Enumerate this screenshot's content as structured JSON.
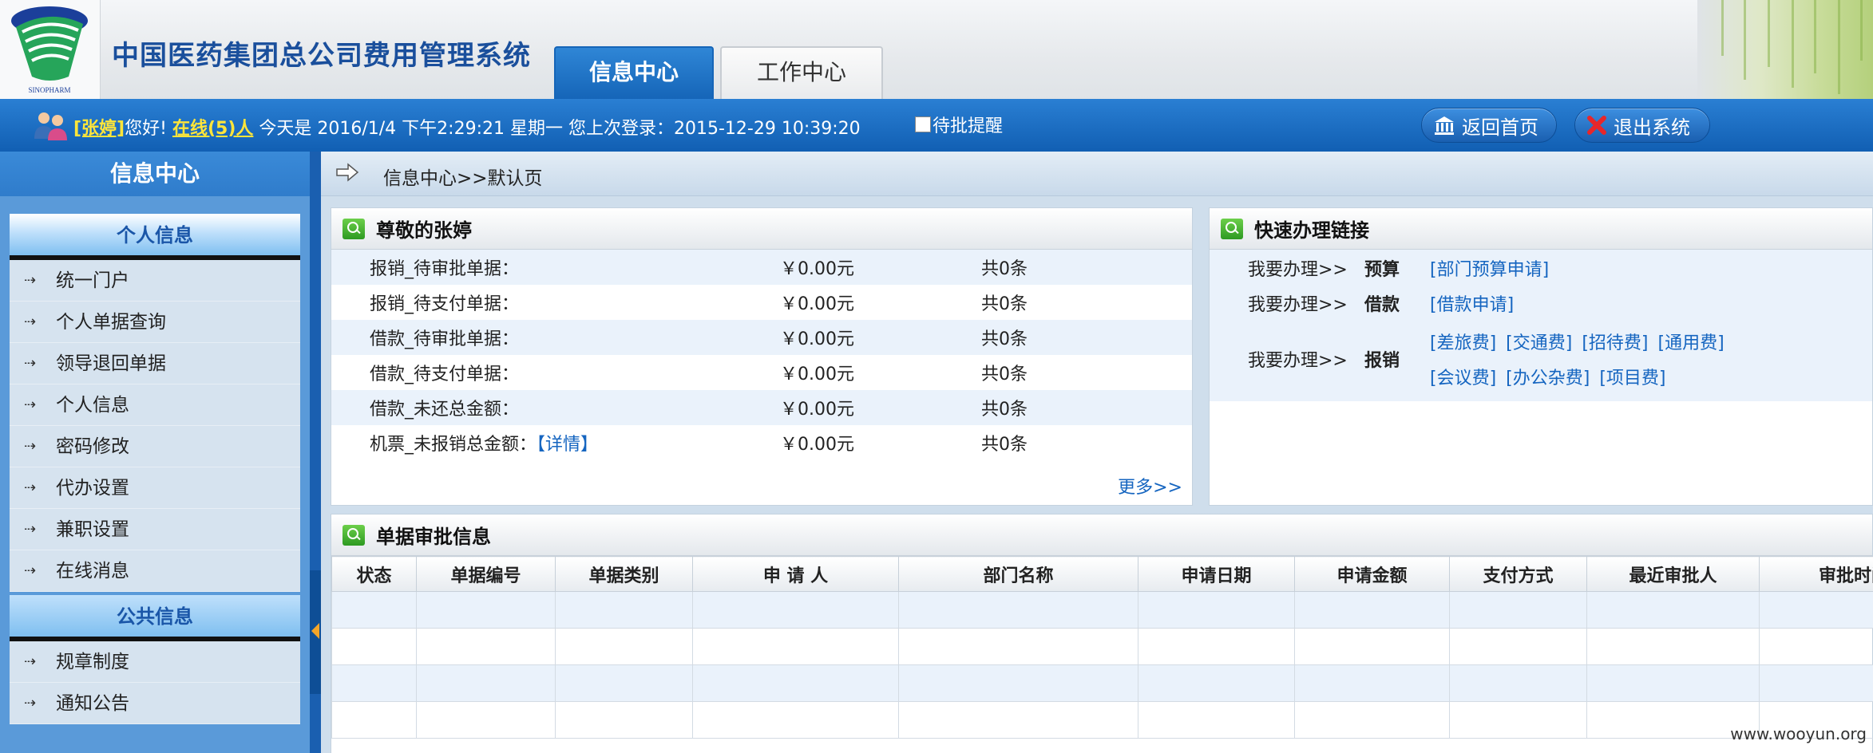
{
  "header": {
    "app_title": "中国医药集团总公司费用管理系统",
    "logo_text": "SINOPHARM",
    "tabs": [
      {
        "label": "信息中心",
        "active": true
      },
      {
        "label": "工作中心",
        "active": false
      }
    ]
  },
  "userbar": {
    "username": "[张婷]",
    "greeting": "您好!",
    "online": "在线(5)人",
    "today_text": "今天是 2016/1/4 下午2:29:21 星期一",
    "last_login_text": "您上次登录：2015-12-29 10:39:20",
    "pending_reminder_label": "待批提醒",
    "home_button": "返回首页",
    "exit_button": "退出系统"
  },
  "sidebar": {
    "title": "信息中心",
    "sections": [
      {
        "title": "个人信息",
        "items": [
          "统一门户",
          "个人单据查询",
          "领导退回单据",
          "个人信息",
          "密码修改",
          "代办设置",
          "兼职设置",
          "在线消息"
        ]
      },
      {
        "title": "公共信息",
        "items": [
          "规章制度",
          "通知公告"
        ]
      }
    ]
  },
  "breadcrumb": "信息中心>>默认页",
  "summary_panel": {
    "title": "尊敬的张婷",
    "rows": [
      {
        "label": "报销_待审批单据：",
        "amount": "￥0.00元",
        "count": "共0条"
      },
      {
        "label": "报销_待支付单据：",
        "amount": "￥0.00元",
        "count": "共0条"
      },
      {
        "label": "借款_待审批单据：",
        "amount": "￥0.00元",
        "count": "共0条"
      },
      {
        "label": "借款_待支付单据：",
        "amount": "￥0.00元",
        "count": "共0条"
      },
      {
        "label": "借款_未还总金额：",
        "amount": "￥0.00元",
        "count": "共0条"
      },
      {
        "label": "机票_未报销总金额：",
        "amount": "￥0.00元",
        "count": "共0条",
        "detail_link": "【详情】"
      }
    ],
    "more_link": "更多>>"
  },
  "quick_panel": {
    "title": "快速办理链接",
    "prefix": "我要办理>>",
    "rows": [
      {
        "category": "预算",
        "links": [
          "[部门预算申请]"
        ]
      },
      {
        "category": "借款",
        "links": [
          "[借款申请]"
        ]
      },
      {
        "category": "报销",
        "links": [
          "[差旅费]",
          "[交通费]",
          "[招待费]",
          "[通用费]"
        ],
        "links_line2": [
          "[会议费]",
          "[办公杂费]",
          "[项目费]"
        ]
      }
    ]
  },
  "audit_panel": {
    "title": "单据审批信息",
    "columns": [
      "状态",
      "单据编号",
      "单据类别",
      "申 请 人",
      "部门名称",
      "申请日期",
      "申请金额",
      "支付方式",
      "最近审批人",
      "审批时间"
    ]
  },
  "watermark": "www.wooyun.org",
  "colors": {
    "primary_blue": "#1a5fb0",
    "title_blue": "#1a4f9c",
    "link_blue": "#1565c0",
    "highlight_yellow": "#ffe53a",
    "row_stripe": "#eaf2fb"
  }
}
